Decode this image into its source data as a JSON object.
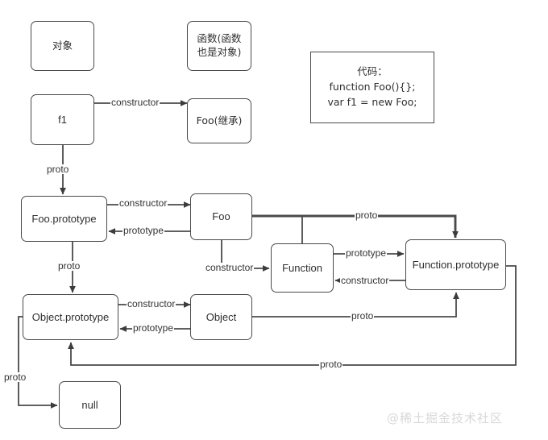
{
  "diagram": {
    "title": "JavaScript prototype chain diagram",
    "stroke_color": "#4a4a4a",
    "text_color": "#2f2f2f",
    "background": "#ffffff",
    "nodes": [
      {
        "id": "object-concept",
        "label": "对象"
      },
      {
        "id": "function-concept",
        "label": "函数(函数\n也是对象)"
      },
      {
        "id": "f1",
        "label": "f1"
      },
      {
        "id": "foo-inherit",
        "label": "Foo(继承)"
      },
      {
        "id": "foo-prototype",
        "label": "Foo.prototype"
      },
      {
        "id": "foo",
        "label": "Foo"
      },
      {
        "id": "function",
        "label": "Function"
      },
      {
        "id": "function-prototype",
        "label": "Function.prototype"
      },
      {
        "id": "object-prototype",
        "label": "Object.prototype"
      },
      {
        "id": "object",
        "label": "Object"
      },
      {
        "id": "null",
        "label": "null"
      }
    ],
    "code_box": {
      "id": "code-box",
      "lines": [
        "代码：",
        "function Foo(){};",
        "var  f1 = new Foo;"
      ]
    },
    "edges": [
      {
        "id": "f1-to-foo-inherit",
        "from": "f1",
        "to": "foo-inherit",
        "label": "constructor"
      },
      {
        "id": "f1-to-foo-prototype",
        "from": "f1",
        "to": "foo-prototype",
        "label": "proto"
      },
      {
        "id": "foo-prototype-to-foo",
        "from": "foo-prototype",
        "to": "foo",
        "label": "constructor"
      },
      {
        "id": "foo-to-foo-prototype",
        "from": "foo",
        "to": "foo-prototype",
        "label": "prototype"
      },
      {
        "id": "foo-prototype-to-object-prototype",
        "from": "foo-prototype",
        "to": "object-prototype",
        "label": "proto"
      },
      {
        "id": "foo-to-function",
        "from": "foo",
        "to": "function",
        "label": "constructor"
      },
      {
        "id": "foo-to-function-prototype",
        "from": "foo",
        "to": "function-prototype",
        "label": "proto"
      },
      {
        "id": "function-to-function-prototype",
        "from": "function",
        "to": "function-prototype",
        "label": "prototype"
      },
      {
        "id": "function-prototype-to-function",
        "from": "function-prototype",
        "to": "function",
        "label": "constructor"
      },
      {
        "id": "object-prototype-to-object",
        "from": "object-prototype",
        "to": "object",
        "label": "constructor"
      },
      {
        "id": "object-to-object-prototype",
        "from": "object",
        "to": "object-prototype",
        "label": "prototype"
      },
      {
        "id": "object-to-function-prototype",
        "from": "object",
        "to": "function-prototype",
        "label": "proto"
      },
      {
        "id": "function-prototype-to-object-prototype",
        "from": "function-prototype",
        "to": "object-prototype",
        "label": "proto"
      },
      {
        "id": "object-prototype-to-null",
        "from": "object-prototype",
        "to": "null",
        "label": "proto"
      }
    ]
  },
  "watermark": {
    "text": "@稀土掘金技术社区"
  }
}
